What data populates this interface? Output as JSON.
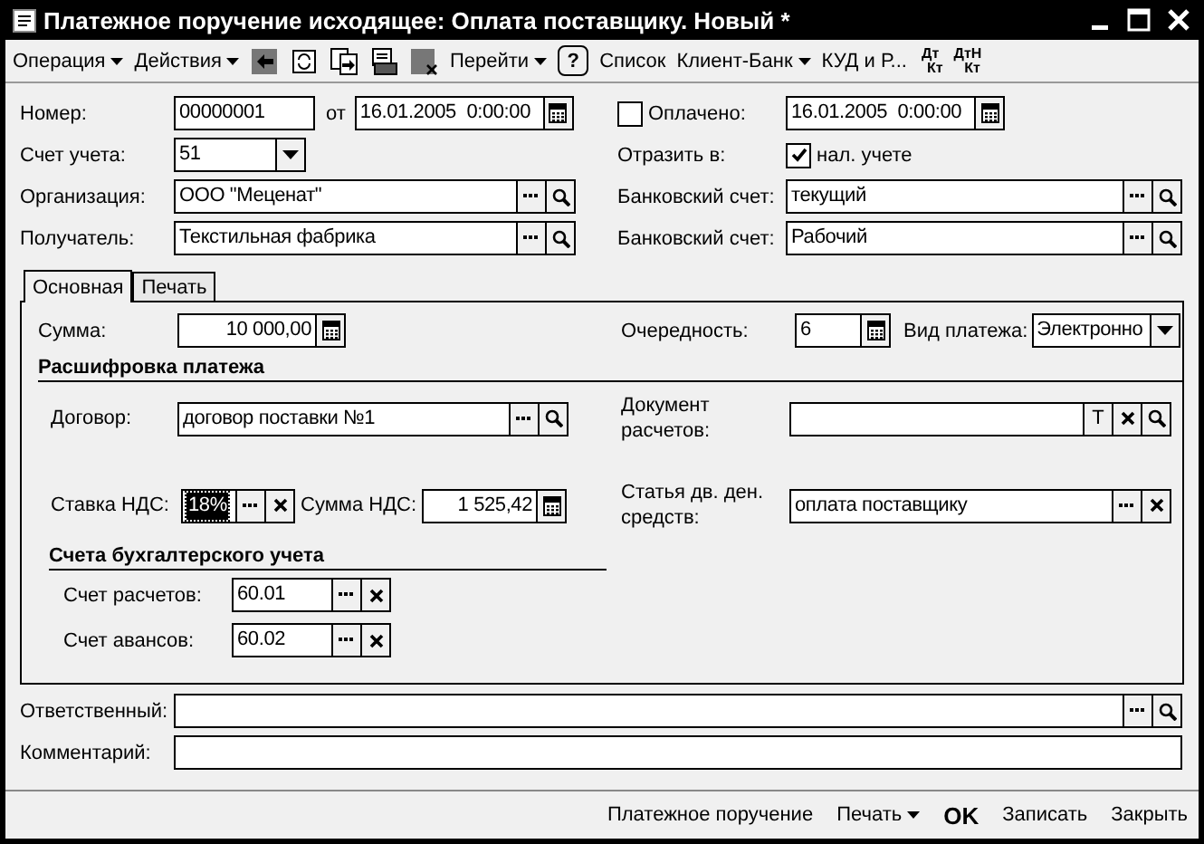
{
  "window": {
    "title": "Платежное поручение исходящее: Оплата поставщику. Новый *"
  },
  "toolbar": [
    {
      "kind": "menu",
      "label": "Операция"
    },
    {
      "kind": "menu",
      "label": "Действия"
    },
    {
      "kind": "icon"
    },
    {
      "kind": "icon"
    },
    {
      "kind": "icon"
    },
    {
      "kind": "icon"
    },
    {
      "kind": "icon"
    },
    {
      "kind": "menu",
      "label": "Перейти"
    },
    {
      "kind": "help",
      "label": "?"
    },
    {
      "kind": "button",
      "label": "Список"
    },
    {
      "kind": "menu",
      "label": "Клиент-Банк"
    },
    {
      "kind": "button",
      "label": "КУД и Р..."
    },
    {
      "kind": "dtkt",
      "top": "Дт",
      "bottom": "Кт"
    },
    {
      "kind": "dtkt",
      "top": "ДтН",
      "bottom": "Кт"
    }
  ],
  "header": {
    "number": {
      "label": "Номер:",
      "value": "00000001"
    },
    "date": {
      "label": "от",
      "value": "16.01.2005  0:00:00",
      "buttons": [
        {
          "kind": "calendar"
        }
      ]
    },
    "paid": {
      "label": "Оплачено:",
      "checked": false,
      "value": "16.01.2005  0:00:00",
      "buttons": [
        {
          "kind": "calendar"
        }
      ]
    },
    "account": {
      "label": "Счет учета:",
      "value": "51",
      "buttons": [
        {
          "kind": "dropdown"
        }
      ]
    },
    "reflect": {
      "label": "Отразить в:",
      "option": "нал. учете",
      "checked": true
    },
    "organization": {
      "label": "Организация:",
      "value": "ООО \"Меценат\"",
      "buttons": [
        {
          "kind": "select"
        },
        {
          "kind": "open"
        }
      ]
    },
    "org_bank_account": {
      "label": "Банковский счет:",
      "value": "текущий",
      "buttons": [
        {
          "kind": "select"
        },
        {
          "kind": "open"
        }
      ]
    },
    "recipient": {
      "label": "Получатель:",
      "value": "Текстильная фабрика",
      "buttons": [
        {
          "kind": "select"
        },
        {
          "kind": "open"
        }
      ]
    },
    "recipient_bank_account": {
      "label": "Банковский счет:",
      "value": "Рабочий",
      "buttons": [
        {
          "kind": "select"
        },
        {
          "kind": "open"
        }
      ]
    }
  },
  "tabs": [
    {
      "label": "Основная",
      "selected": true
    },
    {
      "label": "Печать",
      "selected": false
    }
  ],
  "main": {
    "amount": {
      "label": "Сумма:",
      "value": "10 000,00",
      "buttons": [
        {
          "kind": "calc"
        }
      ]
    },
    "priority": {
      "label": "Очередность:",
      "value": "6",
      "buttons": [
        {
          "kind": "calc"
        }
      ]
    },
    "payment_type": {
      "label": "Вид платежа:",
      "value": "Электронно",
      "buttons": [
        {
          "kind": "dropdown"
        }
      ]
    },
    "breakdown_title": "Расшифровка платежа",
    "contract": {
      "label": "Договор:",
      "value": "договор поставки №1",
      "buttons": [
        {
          "kind": "select"
        },
        {
          "kind": "open"
        }
      ]
    },
    "settlement_document": {
      "label": "Документ расчетов:",
      "buttons": [
        {
          "kind": "text",
          "label": "T"
        },
        {
          "kind": "clear"
        },
        {
          "kind": "open"
        }
      ]
    },
    "vat_rate": {
      "label": "Ставка НДС:",
      "value": "18%",
      "focused": true,
      "buttons": [
        {
          "kind": "select"
        },
        {
          "kind": "clear"
        }
      ]
    },
    "vat_amount": {
      "label": "Сумма НДС:",
      "value": "1 525,42",
      "buttons": [
        {
          "kind": "calc"
        }
      ]
    },
    "cash_flow_item": {
      "label": "Статья дв. ден. средств:",
      "value": "оплата поставщику",
      "buttons": [
        {
          "kind": "select"
        },
        {
          "kind": "clear"
        }
      ]
    },
    "accounts_title": "Счета бухгалтерского учета",
    "settlement_account": {
      "label": "Счет расчетов:",
      "value": "60.01",
      "buttons": [
        {
          "kind": "select"
        },
        {
          "kind": "clear"
        }
      ]
    },
    "advance_account": {
      "label": "Счет авансов:",
      "value": "60.02",
      "buttons": [
        {
          "kind": "select"
        },
        {
          "kind": "clear"
        }
      ]
    }
  },
  "responsible": {
    "label": "Ответственный:",
    "buttons": [
      {
        "kind": "select"
      },
      {
        "kind": "open"
      }
    ]
  },
  "comment": {
    "label": "Комментарий:"
  },
  "footer": [
    {
      "kind": "button",
      "label": "Платежное поручение"
    },
    {
      "kind": "menu",
      "label": "Печать"
    },
    {
      "kind": "default",
      "label": "OK"
    },
    {
      "kind": "button",
      "label": "Записать"
    },
    {
      "kind": "button",
      "label": "Закрыть"
    }
  ]
}
